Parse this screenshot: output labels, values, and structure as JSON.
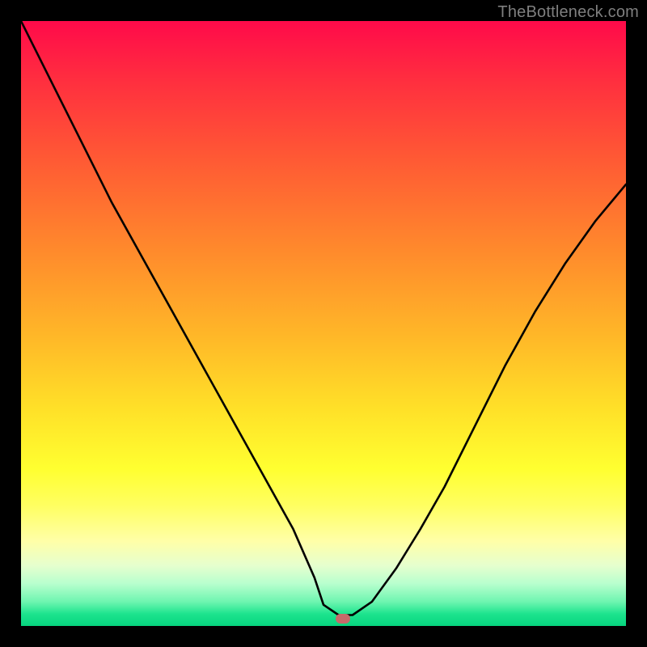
{
  "watermark": "TheBottleneck.com",
  "marker": {
    "x_frac": 0.532,
    "y_frac": 0.988
  },
  "chart_data": {
    "type": "line",
    "title": "",
    "xlabel": "",
    "ylabel": "",
    "xlim": [
      0,
      1
    ],
    "ylim": [
      0,
      1
    ],
    "series": [
      {
        "name": "bottleneck-curve",
        "x": [
          0.0,
          0.05,
          0.1,
          0.15,
          0.2,
          0.25,
          0.3,
          0.35,
          0.4,
          0.45,
          0.485,
          0.5,
          0.525,
          0.548,
          0.58,
          0.62,
          0.66,
          0.7,
          0.75,
          0.8,
          0.85,
          0.9,
          0.95,
          1.0
        ],
        "y": [
          1.0,
          0.9,
          0.8,
          0.7,
          0.61,
          0.52,
          0.43,
          0.34,
          0.25,
          0.16,
          0.08,
          0.035,
          0.018,
          0.018,
          0.04,
          0.095,
          0.16,
          0.23,
          0.33,
          0.43,
          0.52,
          0.6,
          0.67,
          0.73
        ]
      }
    ],
    "annotations": [
      {
        "type": "marker",
        "x": 0.532,
        "y": 0.012,
        "label": "optimal-point"
      }
    ]
  }
}
